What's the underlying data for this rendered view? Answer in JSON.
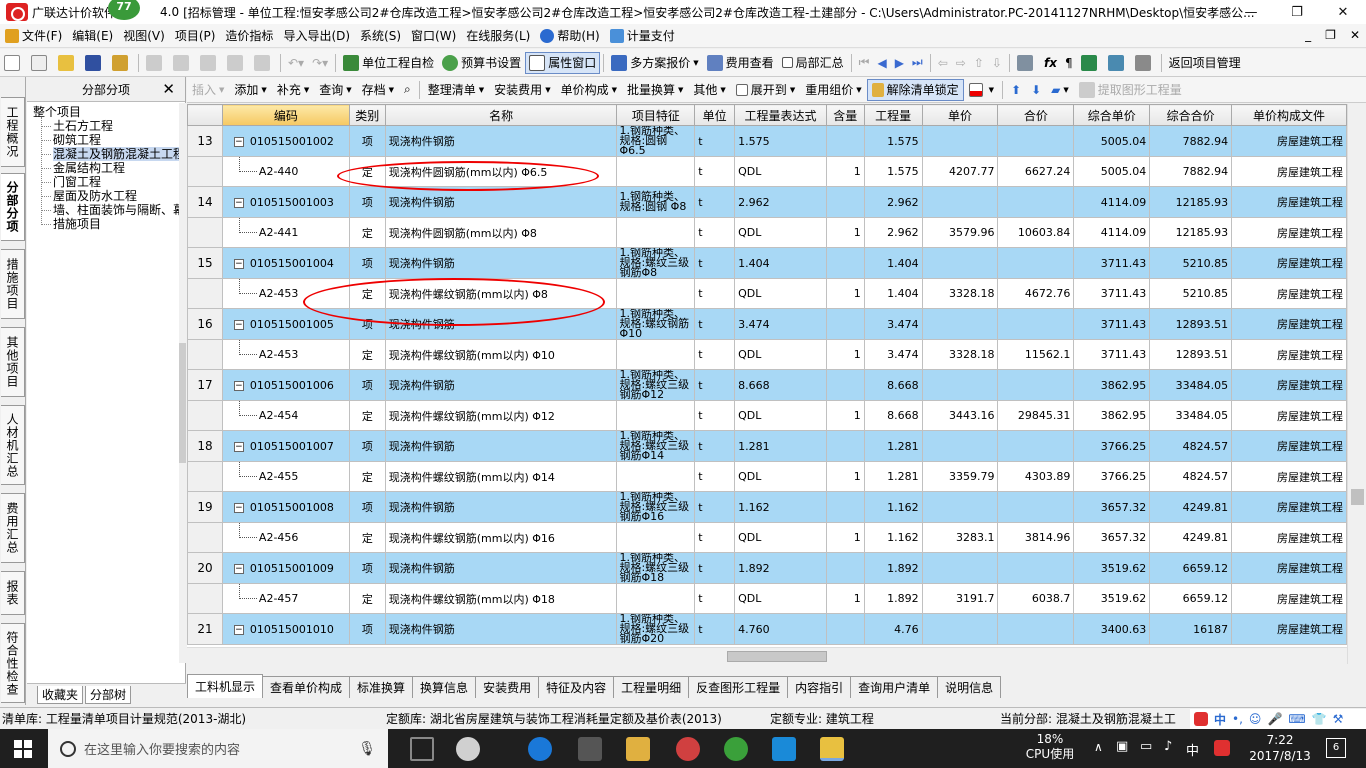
{
  "window": {
    "title": "广联达计价软件",
    "version_tail": "4.0",
    "title_rest": "[招标管理 - 单位工程:恒安孝感公司2#仓库改造工程>恒安孝感公司2#仓库改造工程>恒安孝感公司2#仓库改造工程-土建部分 - C:\\Users\\Administrator.PC-20141127NRHM\\Desktop\\恒安孝感公...",
    "badge": "77",
    "min": "—",
    "max": "❐",
    "close": "✕"
  },
  "menu": [
    {
      "label": "文件(F)",
      "color": "#e0a020"
    },
    {
      "label": "编辑(E)",
      "color": ""
    },
    {
      "label": "视图(V)",
      "color": ""
    },
    {
      "label": "项目(P)",
      "color": ""
    },
    {
      "label": "造价指标",
      "color": ""
    },
    {
      "label": "导入导出(D)",
      "color": ""
    },
    {
      "label": "系统(S)",
      "color": ""
    },
    {
      "label": "窗口(W)",
      "color": ""
    },
    {
      "label": "在线服务(L)",
      "color": ""
    },
    {
      "label": "帮助(H)",
      "color": "#2a6ad0"
    },
    {
      "label": "计量支付",
      "color": "#4a90d9"
    }
  ],
  "mdi": {
    "min": "_",
    "restore": "❐",
    "close": "✕"
  },
  "toolbar1": {
    "check": "单位工程自检",
    "budget": "预算书设置",
    "props": "属性窗口",
    "multi": "多方案报价",
    "fee": "费用查看",
    "local": "局部汇总",
    "back": "返回项目管理"
  },
  "vtabs": [
    "工程概况",
    "分部分项",
    "措施项目",
    "其他项目",
    "人材机汇总",
    "费用汇总",
    "报表",
    "符合性检查"
  ],
  "tree": {
    "title": "分部分项",
    "close": "✕",
    "root": "整个项目",
    "items": [
      "土石方工程",
      "砌筑工程",
      "混凝土及钢筋混凝土工程",
      "金属结构工程",
      "门窗工程",
      "屋面及防水工程",
      "墙、柱面装饰与隔断、幕墙工程",
      "措施项目"
    ],
    "tabs": [
      "收藏夹",
      "分部树"
    ]
  },
  "toolbar2": {
    "insert": "插入",
    "add": "添加",
    "supp": "补充",
    "query": "查询",
    "save": "存档",
    "tidy": "整理清单",
    "install": "安装费用",
    "unitcomp": "单价构成",
    "batch": "批量换算",
    "other": "其他",
    "expand": "展开到",
    "reuse": "重用组价",
    "unlock": "解除清单锁定",
    "extract": "提取图形工程量"
  },
  "table": {
    "headers": [
      "",
      "编码",
      "类别",
      "名称",
      "项目特征",
      "单位",
      "工程量表达式",
      "含量",
      "工程量",
      "单价",
      "合价",
      "综合单价",
      "综合合价",
      "单价构成文件"
    ],
    "rows": [
      {
        "kind": "q",
        "no": "13",
        "code": "010515001002",
        "type": "项",
        "name": "现浇构件钢筋",
        "feat": "1.钢筋种类、规格:圆钢 Φ6.5",
        "unit": "t",
        "expr": "1.575",
        "content": "",
        "qty": "1.575",
        "price": "",
        "total": "",
        "uprice": "5005.04",
        "utotal": "7882.94",
        "file": "房屋建筑工程"
      },
      {
        "kind": "d",
        "no": "",
        "code": "A2-440",
        "type": "定",
        "name": "现浇构件圆钢筋(mm以内) Φ6.5",
        "feat": "",
        "unit": "t",
        "expr": "QDL",
        "content": "1",
        "qty": "1.575",
        "price": "4207.77",
        "total": "6627.24",
        "uprice": "5005.04",
        "utotal": "7882.94",
        "file": "房屋建筑工程"
      },
      {
        "kind": "q",
        "no": "14",
        "code": "010515001003",
        "type": "项",
        "name": "现浇构件钢筋",
        "feat": "1.钢筋种类、规格:圆钢 Φ8",
        "unit": "t",
        "expr": "2.962",
        "content": "",
        "qty": "2.962",
        "price": "",
        "total": "",
        "uprice": "4114.09",
        "utotal": "12185.93",
        "file": "房屋建筑工程"
      },
      {
        "kind": "d",
        "no": "",
        "code": "A2-441",
        "type": "定",
        "name": "现浇构件圆钢筋(mm以内) Φ8",
        "feat": "",
        "unit": "t",
        "expr": "QDL",
        "content": "1",
        "qty": "2.962",
        "price": "3579.96",
        "total": "10603.84",
        "uprice": "4114.09",
        "utotal": "12185.93",
        "file": "房屋建筑工程"
      },
      {
        "kind": "q",
        "no": "15",
        "code": "010515001004",
        "type": "项",
        "name": "现浇构件钢筋",
        "feat": "1.钢筋种类、规格:螺纹三级钢筋Φ8",
        "unit": "t",
        "expr": "1.404",
        "content": "",
        "qty": "1.404",
        "price": "",
        "total": "",
        "uprice": "3711.43",
        "utotal": "5210.85",
        "file": "房屋建筑工程"
      },
      {
        "kind": "d",
        "no": "",
        "code": "A2-453",
        "type": "定",
        "name": "现浇构件螺纹钢筋(mm以内) Φ8",
        "feat": "",
        "unit": "t",
        "expr": "QDL",
        "content": "1",
        "qty": "1.404",
        "price": "3328.18",
        "total": "4672.76",
        "uprice": "3711.43",
        "utotal": "5210.85",
        "file": "房屋建筑工程"
      },
      {
        "kind": "q",
        "no": "16",
        "code": "010515001005",
        "type": "项",
        "name": "现浇构件钢筋",
        "feat": "1.钢筋种类、规格:螺纹钢筋 Φ10",
        "unit": "t",
        "expr": "3.474",
        "content": "",
        "qty": "3.474",
        "price": "",
        "total": "",
        "uprice": "3711.43",
        "utotal": "12893.51",
        "file": "房屋建筑工程"
      },
      {
        "kind": "d",
        "no": "",
        "code": "A2-453",
        "type": "定",
        "name": "现浇构件螺纹钢筋(mm以内) Φ10",
        "feat": "",
        "unit": "t",
        "expr": "QDL",
        "content": "1",
        "qty": "3.474",
        "price": "3328.18",
        "total": "11562.1",
        "uprice": "3711.43",
        "utotal": "12893.51",
        "file": "房屋建筑工程"
      },
      {
        "kind": "q",
        "no": "17",
        "code": "010515001006",
        "type": "项",
        "name": "现浇构件钢筋",
        "feat": "1.钢筋种类、规格:螺纹三级钢筋Φ12",
        "unit": "t",
        "expr": "8.668",
        "content": "",
        "qty": "8.668",
        "price": "",
        "total": "",
        "uprice": "3862.95",
        "utotal": "33484.05",
        "file": "房屋建筑工程"
      },
      {
        "kind": "d",
        "no": "",
        "code": "A2-454",
        "type": "定",
        "name": "现浇构件螺纹钢筋(mm以内) Φ12",
        "feat": "",
        "unit": "t",
        "expr": "QDL",
        "content": "1",
        "qty": "8.668",
        "price": "3443.16",
        "total": "29845.31",
        "uprice": "3862.95",
        "utotal": "33484.05",
        "file": "房屋建筑工程"
      },
      {
        "kind": "q",
        "no": "18",
        "code": "010515001007",
        "type": "项",
        "name": "现浇构件钢筋",
        "feat": "1.钢筋种类、规格:螺纹三级钢筋Φ14",
        "unit": "t",
        "expr": "1.281",
        "content": "",
        "qty": "1.281",
        "price": "",
        "total": "",
        "uprice": "3766.25",
        "utotal": "4824.57",
        "file": "房屋建筑工程"
      },
      {
        "kind": "d",
        "no": "",
        "code": "A2-455",
        "type": "定",
        "name": "现浇构件螺纹钢筋(mm以内) Φ14",
        "feat": "",
        "unit": "t",
        "expr": "QDL",
        "content": "1",
        "qty": "1.281",
        "price": "3359.79",
        "total": "4303.89",
        "uprice": "3766.25",
        "utotal": "4824.57",
        "file": "房屋建筑工程"
      },
      {
        "kind": "q",
        "no": "19",
        "code": "010515001008",
        "type": "项",
        "name": "现浇构件钢筋",
        "feat": "1.钢筋种类、规格:螺纹三级钢筋Φ16",
        "unit": "t",
        "expr": "1.162",
        "content": "",
        "qty": "1.162",
        "price": "",
        "total": "",
        "uprice": "3657.32",
        "utotal": "4249.81",
        "file": "房屋建筑工程"
      },
      {
        "kind": "d",
        "no": "",
        "code": "A2-456",
        "type": "定",
        "name": "现浇构件螺纹钢筋(mm以内) Φ16",
        "feat": "",
        "unit": "t",
        "expr": "QDL",
        "content": "1",
        "qty": "1.162",
        "price": "3283.1",
        "total": "3814.96",
        "uprice": "3657.32",
        "utotal": "4249.81",
        "file": "房屋建筑工程"
      },
      {
        "kind": "q",
        "no": "20",
        "code": "010515001009",
        "type": "项",
        "name": "现浇构件钢筋",
        "feat": "1.钢筋种类、规格:螺纹三级钢筋Φ18",
        "unit": "t",
        "expr": "1.892",
        "content": "",
        "qty": "1.892",
        "price": "",
        "total": "",
        "uprice": "3519.62",
        "utotal": "6659.12",
        "file": "房屋建筑工程"
      },
      {
        "kind": "d",
        "no": "",
        "code": "A2-457",
        "type": "定",
        "name": "现浇构件螺纹钢筋(mm以内) Φ18",
        "feat": "",
        "unit": "t",
        "expr": "QDL",
        "content": "1",
        "qty": "1.892",
        "price": "3191.7",
        "total": "6038.7",
        "uprice": "3519.62",
        "utotal": "6659.12",
        "file": "房屋建筑工程"
      },
      {
        "kind": "q",
        "no": "21",
        "code": "010515001010",
        "type": "项",
        "name": "现浇构件钢筋",
        "feat": "1.钢筋种类、规格:螺纹三级钢筋Φ20",
        "unit": "t",
        "expr": "4.760",
        "content": "",
        "qty": "4.76",
        "price": "",
        "total": "",
        "uprice": "3400.63",
        "utotal": "16187",
        "file": "房屋建筑工程"
      }
    ]
  },
  "bottom_tabs": [
    "工料机显示",
    "查看单价构成",
    "标准换算",
    "换算信息",
    "安装费用",
    "特征及内容",
    "工程量明细",
    "反查图形工程量",
    "内容指引",
    "查询用户清单",
    "说明信息"
  ],
  "status": {
    "list_lib": "清单库:  工程量清单项目计量规范(2013-湖北)",
    "quota_lib": "定额库:  湖北省房屋建筑与装饰工程消耗量定额及基价表(2013)",
    "quota_major": "定额专业:  建筑工程",
    "current": "当前分部:  混凝土及钢筋混凝土工",
    "ime": "中"
  },
  "taskbar": {
    "search_placeholder": "在这里输入你要搜索的内容",
    "cpu_pct": "18%",
    "cpu_label": "CPU使用",
    "ime": "中",
    "time": "7:22",
    "date": "2017/8/13",
    "notif": "6"
  }
}
